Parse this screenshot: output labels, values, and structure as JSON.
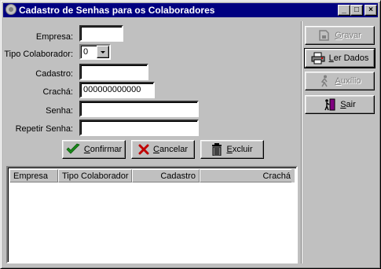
{
  "window": {
    "title": "Cadastro de Senhas para os Colaboradores",
    "controls": {
      "minimize": "_",
      "maximize": "□",
      "close": "×"
    }
  },
  "form": {
    "empresa": {
      "label": "Empresa:",
      "value": ""
    },
    "tipo_colaborador": {
      "label": "Tipo Colaborador:",
      "value": "0"
    },
    "cadastro": {
      "label": "Cadastro:",
      "value": ""
    },
    "cracha": {
      "label": "Crachá:",
      "value": "000000000000"
    },
    "senha": {
      "label": "Senha:",
      "value": ""
    },
    "repetir_senha": {
      "label": "Repetir Senha:",
      "value": ""
    }
  },
  "actions": {
    "confirmar": {
      "accel": "C",
      "rest": "onfirmar"
    },
    "cancelar": {
      "accel": "C",
      "rest": "ancelar"
    },
    "excluir": {
      "accel": "E",
      "rest": "xcluir"
    }
  },
  "side": {
    "gravar": {
      "accel": "G",
      "rest": "ravar",
      "enabled": false
    },
    "ler_dados": {
      "accel": "L",
      "rest": "er Dados",
      "enabled": true
    },
    "auxilio": {
      "accel": "A",
      "rest": "uxílio",
      "enabled": false
    },
    "sair": {
      "accel": "S",
      "rest": "air",
      "enabled": true
    }
  },
  "table": {
    "columns": [
      "Empresa",
      "Tipo Colaborador",
      "Cadastro",
      "Crachá"
    ],
    "rows": []
  },
  "colors": {
    "titlebar": "#000080",
    "face": "#c0c0c0",
    "confirm_icon": "#1a8a1a",
    "cancel_icon": "#c00000"
  }
}
